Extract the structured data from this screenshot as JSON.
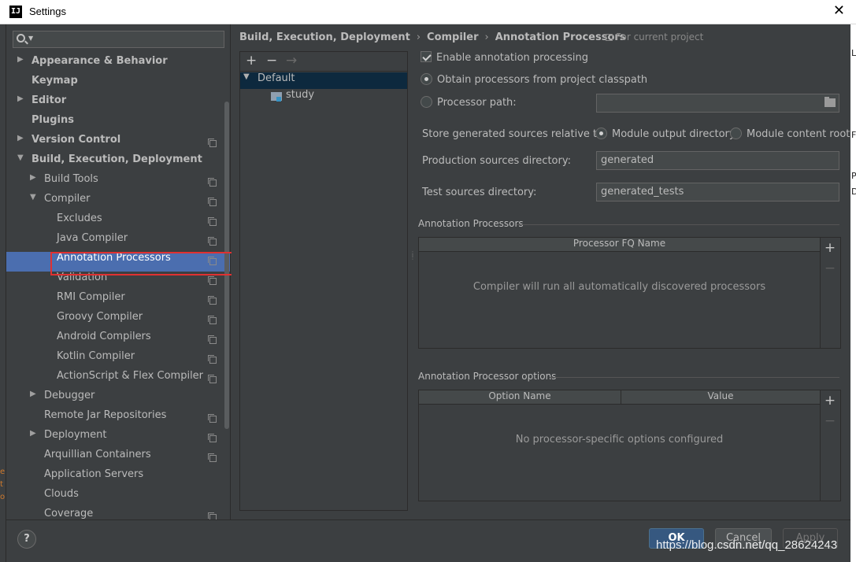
{
  "window": {
    "title": "Settings",
    "app_icon_text": "IJ",
    "close_glyph": "✕"
  },
  "search": {
    "value": "",
    "placeholder": ""
  },
  "sidebar": {
    "items": [
      {
        "label": "Appearance & Behavior",
        "bold": true,
        "arrow": "▶"
      },
      {
        "label": "Keymap",
        "bold": true,
        "arrow": ""
      },
      {
        "label": "Editor",
        "bold": true,
        "arrow": "▶"
      },
      {
        "label": "Plugins",
        "bold": true,
        "arrow": ""
      },
      {
        "label": "Version Control",
        "bold": true,
        "arrow": "▶"
      },
      {
        "label": "Build, Execution, Deployment",
        "bold": true,
        "arrow": "▼"
      },
      {
        "label": "Build Tools",
        "arrow": "▶"
      },
      {
        "label": "Compiler",
        "arrow": "▼"
      },
      {
        "label": "Excludes",
        "arrow": ""
      },
      {
        "label": "Java Compiler",
        "arrow": ""
      },
      {
        "label": "Annotation Processors",
        "arrow": "",
        "selected": true
      },
      {
        "label": "Validation",
        "arrow": ""
      },
      {
        "label": "RMI Compiler",
        "arrow": ""
      },
      {
        "label": "Groovy Compiler",
        "arrow": ""
      },
      {
        "label": "Android Compilers",
        "arrow": ""
      },
      {
        "label": "Kotlin Compiler",
        "arrow": ""
      },
      {
        "label": "ActionScript & Flex Compiler",
        "arrow": ""
      },
      {
        "label": "Debugger",
        "arrow": "▶"
      },
      {
        "label": "Remote Jar Repositories",
        "arrow": ""
      },
      {
        "label": "Deployment",
        "arrow": "▶"
      },
      {
        "label": "Arquillian Containers",
        "arrow": ""
      },
      {
        "label": "Application Servers",
        "arrow": ""
      },
      {
        "label": "Clouds",
        "arrow": ""
      },
      {
        "label": "Coverage",
        "arrow": ""
      }
    ]
  },
  "breadcrumb": {
    "parts": [
      "Build, Execution, Deployment",
      "Compiler",
      "Annotation Processors"
    ],
    "separator": "›",
    "scope_note": "For current project"
  },
  "profiles": {
    "toolbar": {
      "add": "+",
      "remove": "−",
      "move": "→"
    },
    "items": [
      {
        "label": "Default",
        "arrow": "▼"
      },
      {
        "label": "study"
      }
    ]
  },
  "options": {
    "enable_processing": "Enable annotation processing",
    "obtain_from_classpath": "Obtain processors from project classpath",
    "processor_path": "Processor path:",
    "processor_path_value": "",
    "store_label": "Store generated sources relative to:",
    "module_output": "Module output directory",
    "module_content": "Module content root",
    "production_label": "Production sources directory:",
    "production_value": "generated",
    "test_label": "Test sources directory:",
    "test_value": "generated_tests"
  },
  "processors_table": {
    "section_title": "Annotation Processors",
    "columns": [
      "Processor FQ Name"
    ],
    "empty_text": "Compiler will run all automatically discovered processors",
    "add": "+",
    "remove": "−"
  },
  "options_table": {
    "section_title": "Annotation Processor options",
    "columns": [
      "Option Name",
      "Value"
    ],
    "empty_text": "No processor-specific options configured",
    "add": "+",
    "remove": "−"
  },
  "buttons": {
    "help": "?",
    "ok": "OK",
    "cancel": "Cancel",
    "apply": "Apply"
  },
  "watermark": "https://blog.csdn.net/qq_28624243",
  "edge_right_chars": [
    "L",
    "F",
    "P",
    "D"
  ],
  "edge_left_chars": [
    "e",
    "t",
    "o"
  ]
}
